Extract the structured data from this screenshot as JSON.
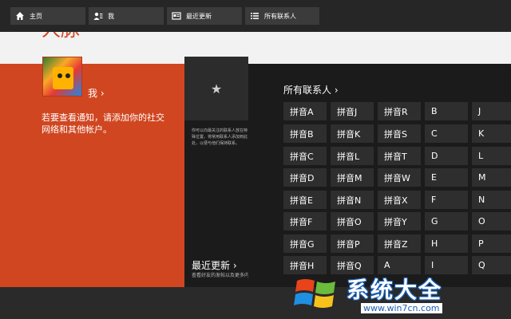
{
  "appbar": {
    "buttons": [
      {
        "label": "主页",
        "icon": "home-icon"
      },
      {
        "label": "我",
        "icon": "me-icon"
      },
      {
        "label": "最近更新",
        "icon": "updates-icon"
      },
      {
        "label": "所有联系人",
        "icon": "list-icon"
      }
    ]
  },
  "page": {
    "title": "人脉"
  },
  "me": {
    "link_label": "我 ›",
    "notice": "若要查看通知，请添加你的社交网络和其他帐户。"
  },
  "favorites": {
    "icon": "star-icon",
    "hint": "你可以向最关注的联系人放在特殊位置。将常用联系人添加到此处，以便与他们保持联系。"
  },
  "recent": {
    "label": "最近更新 ›",
    "sub": "查看好友的发帖以及更多内容"
  },
  "all_contacts": {
    "title": "所有联系人 ›",
    "columns": [
      [
        "拼音A",
        "拼音B",
        "拼音C",
        "拼音D",
        "拼音E",
        "拼音F",
        "拼音G",
        "拼音H"
      ],
      [
        "拼音J",
        "拼音K",
        "拼音L",
        "拼音M",
        "拼音N",
        "拼音O",
        "拼音P",
        "拼音Q"
      ],
      [
        "拼音R",
        "拼音S",
        "拼音T",
        "拼音W",
        "拼音X",
        "拼音Y",
        "拼音Z",
        "A"
      ],
      [
        "B",
        "C",
        "D",
        "E",
        "F",
        "G",
        "H",
        "I"
      ],
      [
        "J",
        "K",
        "L",
        "M",
        "N",
        "O",
        "P",
        "Q"
      ]
    ]
  },
  "watermark": {
    "title": "系统大全",
    "url": "www.win7cn.com"
  },
  "colors": {
    "accent": "#d04620",
    "background": "#1b1b1b",
    "tile": "#2e2e2e"
  }
}
